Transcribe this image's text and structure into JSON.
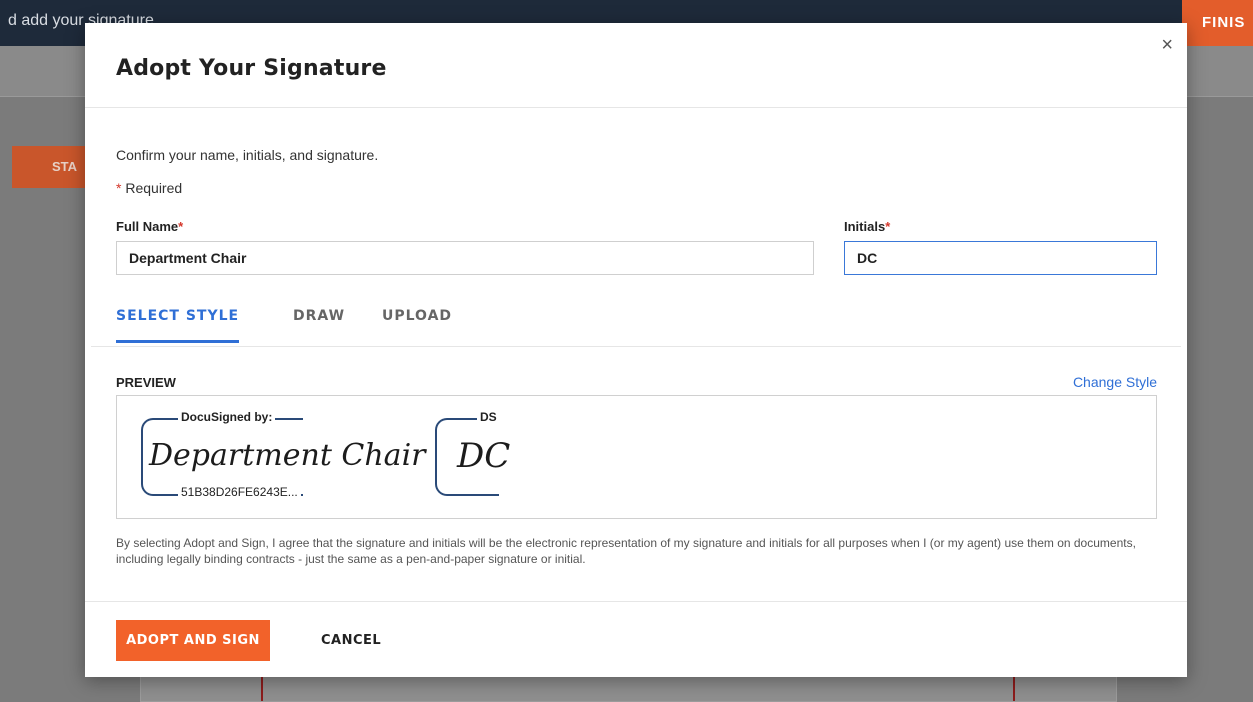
{
  "background": {
    "topbar_text": "d add your signature",
    "finish_label": "FINIS",
    "start_label": "STA"
  },
  "modal": {
    "title": "Adopt Your Signature",
    "close_glyph": "×",
    "intro": "Confirm your name, initials, and signature.",
    "required_star": "*",
    "required_text": "Required",
    "full_name_label": "Full Name",
    "full_name_value": "Department Chair",
    "initials_label": "Initials",
    "initials_value": "DC",
    "label_star": "*",
    "tabs": [
      {
        "label": "SELECT STYLE",
        "active": true
      },
      {
        "label": "DRAW",
        "active": false
      },
      {
        "label": "UPLOAD",
        "active": false
      }
    ],
    "preview_label": "PREVIEW",
    "change_style": "Change Style",
    "signature": {
      "header": "DocuSigned by:",
      "script": "Department Chair",
      "id": "51B38D26FE6243E..."
    },
    "initials_preview": {
      "header": "DS",
      "script": "DC"
    },
    "legal_text": "By selecting Adopt and Sign, I agree that the signature and initials will be the electronic representation of my signature and initials for all purposes when I (or my agent) use them on documents, including legally binding contracts - just the same as a pen-and-paper signature or initial.",
    "adopt_button": "ADOPT AND SIGN",
    "cancel_button": "CANCEL"
  },
  "colors": {
    "accent": "#f2622a",
    "link": "#2f6fd6",
    "required": "#d4362a",
    "signature_frame": "#2a4a78"
  }
}
